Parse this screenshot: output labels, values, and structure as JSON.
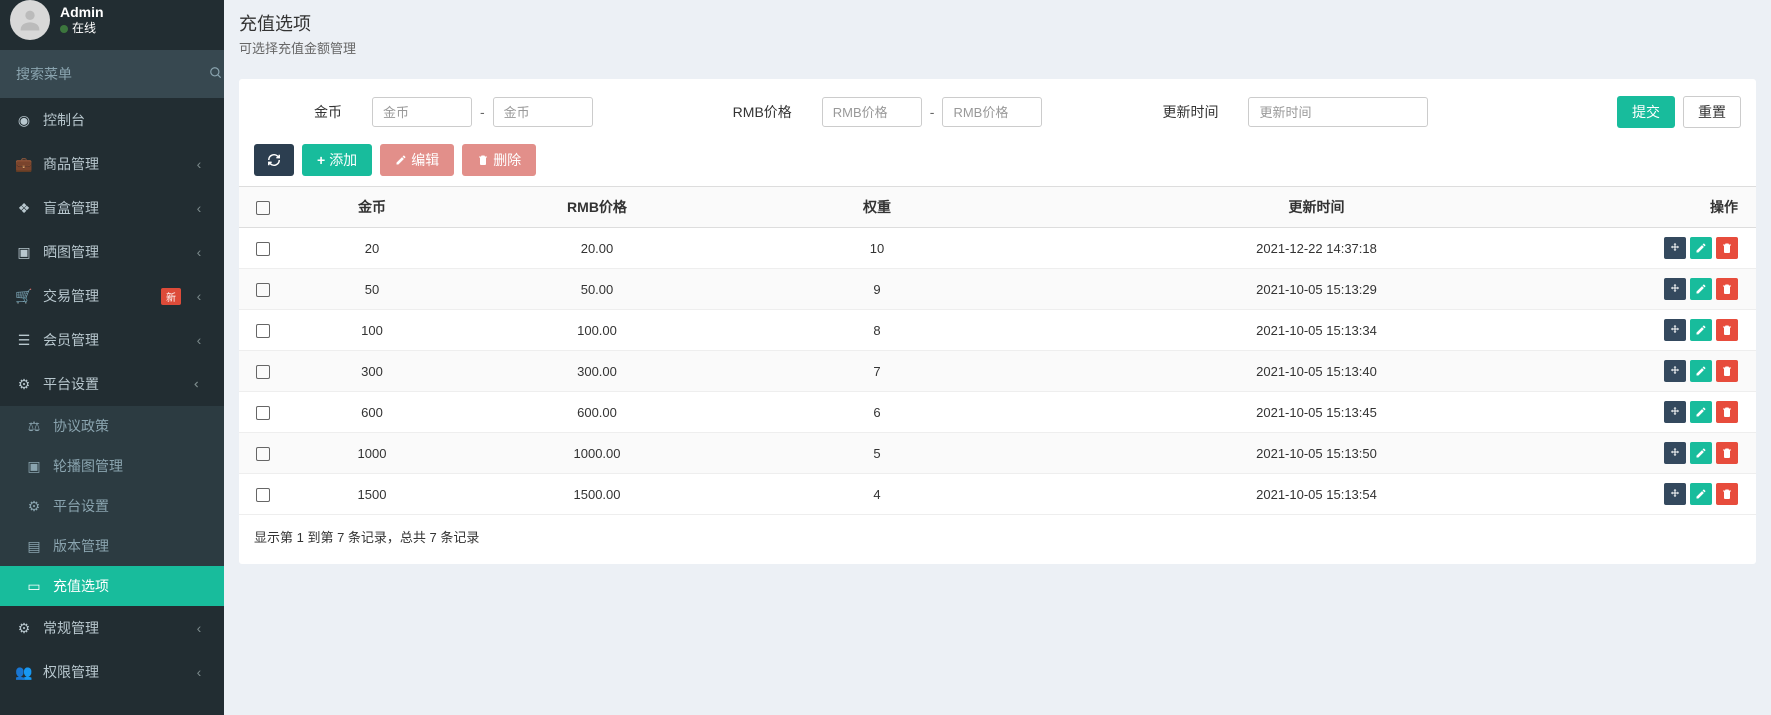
{
  "user": {
    "name": "Admin",
    "status": "在线"
  },
  "search": {
    "placeholder": "搜索菜单"
  },
  "nav": {
    "items": [
      {
        "label": "控制台",
        "icon": "dashboard",
        "expandable": false
      },
      {
        "label": "商品管理",
        "icon": "briefcase",
        "expandable": true
      },
      {
        "label": "盲盒管理",
        "icon": "gift",
        "expandable": true
      },
      {
        "label": "晒图管理",
        "icon": "image",
        "expandable": true
      },
      {
        "label": "交易管理",
        "icon": "cart",
        "expandable": true,
        "badge": "新"
      },
      {
        "label": "会员管理",
        "icon": "list",
        "expandable": true
      },
      {
        "label": "平台设置",
        "icon": "cog",
        "expandable": true,
        "expanded": true,
        "children": [
          {
            "label": "协议政策",
            "icon": "scale"
          },
          {
            "label": "轮播图管理",
            "icon": "image"
          },
          {
            "label": "平台设置",
            "icon": "cog"
          },
          {
            "label": "版本管理",
            "icon": "file"
          },
          {
            "label": "充值选项",
            "icon": "card",
            "active": true
          }
        ]
      },
      {
        "label": "常规管理",
        "icon": "cog",
        "expandable": true
      },
      {
        "label": "权限管理",
        "icon": "users",
        "expandable": true
      }
    ]
  },
  "header": {
    "title": "充值选项",
    "subtitle": "可选择充值金额管理"
  },
  "filters": {
    "gold_label": "金币",
    "gold_ph": "金币",
    "rmb_label": "RMB价格",
    "rmb_ph": "RMB价格",
    "update_label": "更新时间",
    "update_ph": "更新时间",
    "sep": "-",
    "submit": "提交",
    "reset": "重置"
  },
  "toolbar": {
    "add": "添加",
    "edit": "编辑",
    "del": "删除"
  },
  "table": {
    "headers": {
      "gold": "金币",
      "rmb": "RMB价格",
      "weight": "权重",
      "time": "更新时间",
      "ops": "操作"
    },
    "rows": [
      {
        "gold": "20",
        "rmb": "20.00",
        "weight": "10",
        "time": "2021-12-22 14:37:18"
      },
      {
        "gold": "50",
        "rmb": "50.00",
        "weight": "9",
        "time": "2021-10-05 15:13:29"
      },
      {
        "gold": "100",
        "rmb": "100.00",
        "weight": "8",
        "time": "2021-10-05 15:13:34"
      },
      {
        "gold": "300",
        "rmb": "300.00",
        "weight": "7",
        "time": "2021-10-05 15:13:40"
      },
      {
        "gold": "600",
        "rmb": "600.00",
        "weight": "6",
        "time": "2021-10-05 15:13:45"
      },
      {
        "gold": "1000",
        "rmb": "1000.00",
        "weight": "5",
        "time": "2021-10-05 15:13:50"
      },
      {
        "gold": "1500",
        "rmb": "1500.00",
        "weight": "4",
        "time": "2021-10-05 15:13:54"
      }
    ],
    "footer": "显示第 1 到第 7 条记录，总共 7 条记录"
  }
}
